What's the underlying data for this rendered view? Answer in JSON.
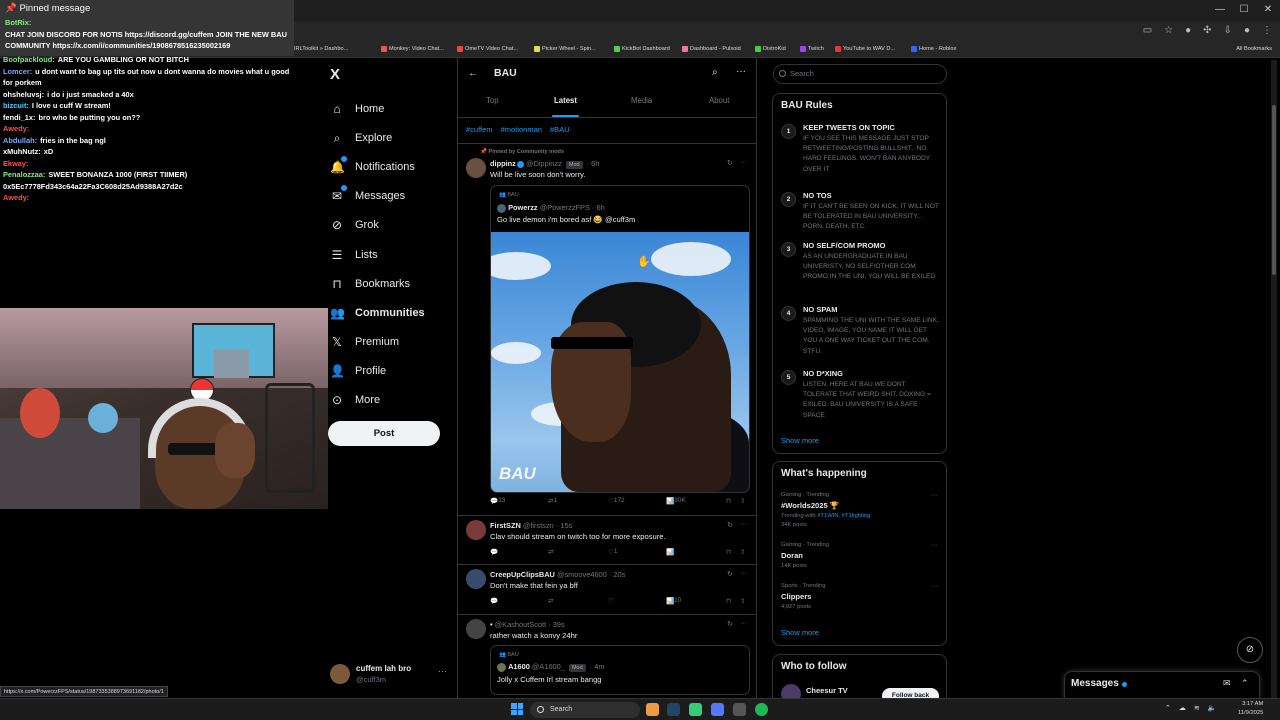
{
  "chat": {
    "pinned_title": "Pinned message",
    "pinned_author": "BotRix:",
    "pinned_text": "CHAT JOIN DISCORD FOR NOTIS https://discord.gg/cuffem JOIN THE NEW BAU COMMUNITY https://x.com/i/communities/1908678516235002169",
    "messages": [
      {
        "user": "Boofpackloud:",
        "text": "ARE YOU GAMBLING OR NOT BITCH",
        "color": "#7ef27e"
      },
      {
        "user": "Lomcer:",
        "text": "u dont want to bag up tits out now u dont wanna do movies what u good for porkem",
        "color": "#7aa8ff"
      },
      {
        "user": "ohsheluvsj:",
        "text": "i do i just smacked a 40x",
        "color": "#ffffff"
      },
      {
        "user": "bizcuit:",
        "text": "I love u cuff W stream!",
        "color": "#4fd0ff"
      },
      {
        "user": "fendi_1x:",
        "text": "bro who be putting you on??",
        "color": "#ffffff"
      },
      {
        "user": "Awedy:",
        "text": "",
        "color": "#ff5050"
      },
      {
        "user": "Abdullah:",
        "text": "fries in the bag ngl",
        "color": "#7aa8ff"
      },
      {
        "user": "xMuhNutz:",
        "text": "xD",
        "color": "#ffffff"
      },
      {
        "user": "Ekway:",
        "text": "",
        "color": "#ff5050"
      },
      {
        "user": "Penalozzaa:",
        "text": "SWEET BONANZA 1000 (FIRST TIIMER)",
        "color": "#7ef27e"
      },
      {
        "user": "",
        "text": "0x5Ec7778Fd343c64a22Fa3C608d25Ad9388A27d2c",
        "color": "#ffffff"
      },
      {
        "user": "Awedy:",
        "text": "",
        "color": "#ff5050"
      }
    ]
  },
  "bookmarks": [
    "IRLToolkit » Dashbo...",
    "Monkey: Video Chat...",
    "OmeTV Video Chat...",
    "Picker Wheel - Spin...",
    "KickBot Dashboard",
    "Dashboard - Pulsoid",
    "DistroKid",
    "Twitch",
    "YouTube to WAV D...",
    "Home - Roblox",
    "All Bookmarks"
  ],
  "nav": {
    "logo": "X",
    "items": [
      "Home",
      "Explore",
      "Notifications",
      "Messages",
      "Grok",
      "Lists",
      "Bookmarks",
      "Communities",
      "Premium",
      "Profile",
      "More"
    ],
    "icons": [
      "home-icon",
      "search-icon",
      "bell-icon",
      "mail-icon",
      "grok-icon",
      "list-icon",
      "bookmark-icon",
      "communities-icon",
      "x-icon",
      "profile-icon",
      "more-icon"
    ],
    "active": "Communities",
    "post_label": "Post",
    "account_name": "cuffem lah bro",
    "account_handle": "@cuff3m"
  },
  "community": {
    "back_glyph": "←",
    "title": "BAU",
    "tabs": [
      "Top",
      "Latest",
      "Media",
      "About"
    ],
    "active_tab": "Latest",
    "tags": [
      "#cuffem",
      "#motionman",
      "#BAU"
    ]
  },
  "tweets": {
    "t1": {
      "pinned": "Pinned by Community mods",
      "name": "dippinz",
      "handle": "@Dippinzz",
      "badge": "Mod",
      "time": "· 6h",
      "text": "Will be live soon don't worry.",
      "quote_community": "BAU",
      "quote_name": "Powerzz",
      "quote_handle": "@PowerzzFPS · 6h",
      "quote_text": "Go live demon i'm bored asf 😂 @cuff3m",
      "watermark": "BAU",
      "replies": "13",
      "reposts": "1",
      "likes": "172",
      "views": "30K"
    },
    "t2": {
      "name": "FirstSZN",
      "handle": "@firstszn · 15s",
      "text": "Clav should stream on twitch too for more exposure.",
      "likes": "1"
    },
    "t3": {
      "name": "CreepUpClipsBAU",
      "handle": "@smoove4600 · 20s",
      "text": "Don't make that fein ya bff",
      "views": "10"
    },
    "t4": {
      "name": "•",
      "handle": "@KashoutScott · 39s",
      "text": "rather watch a konvy 24hr",
      "quote_community": "BAU",
      "quote_name": "A1600",
      "quote_handle": "@A1600_",
      "quote_badge": "Mod",
      "quote_time": "· 4m",
      "quote_text": "Jolly x Cuffem Irl stream bangg"
    }
  },
  "right": {
    "search_placeholder": "Search",
    "rules_title": "BAU Rules",
    "rules": [
      {
        "n": "1",
        "title": "KEEP TWEETS ON TOPIC",
        "desc": "IF YOU SEE THIS MESSAGE JUST STOP RETWEETING/POSTING BULLSHIT.. NO HARD FEELINGS. WON'T BAN ANYBODY OVER IT"
      },
      {
        "n": "2",
        "title": "NO TOS",
        "desc": "IF IT CAN'T BE SEEN ON KICK, IT WILL NOT BE TOLERATED IN BAU UNIVERSITY... PORN, DEATH, ETC."
      },
      {
        "n": "3",
        "title": "NO SELF/COM PROMO",
        "desc": "AS AN UNDERGRADUATE IN BAU UNIVERISTY, NO SELF/OTHER COM PROMO IN THE UNI. YOU WILL BE EXILED"
      },
      {
        "n": "4",
        "title": "NO SPAM",
        "desc": "SPAMMING THE UNI WITH THE SAME LINK, VIDEO, IMAGE, YOU NAME IT WILL GET YOU A ONE WAY TICKET OUT THE COM. STFU."
      },
      {
        "n": "5",
        "title": "NO D*XING",
        "desc": "LISTEN. HERE AT BAU WE DONT TOLERATE THAT WEIRD SHIT. DOXING = EXILED. BAU UNIVERSITY IS A SAFE SPACE"
      }
    ],
    "show_more": "Show more",
    "happening_title": "What's happening",
    "trends": [
      {
        "cat": "Gaming · Trending",
        "name": "#Worlds2025 🏆",
        "sub_prefix": "Trending with ",
        "sub_link": "#T1WIN, #T1fighting"
      },
      {
        "cat": "Gaming · Trending",
        "name": "Doran",
        "sub_prefix": "14K posts",
        "sub_link": ""
      },
      {
        "cat": "Sports · Trending",
        "name": "Clippers",
        "sub_prefix": "4,927 posts",
        "sub_link": ""
      }
    ],
    "trend1_posts": "34K posts",
    "show_more2": "Show more",
    "follow_title": "Who to follow",
    "follow_name": "Cheesur TV",
    "follow_btn": "Follow back"
  },
  "dock": {
    "title": "Messages"
  },
  "status_url": "https://x.com/PowerzzFPS/status/1987335388973691182/photo/1",
  "taskbar": {
    "search": "Search",
    "time": "3:17 AM",
    "date": "11/9/2025"
  },
  "colors": {
    "accent": "#1d9bf0",
    "bg": "#000000",
    "border": "#2f3336",
    "muted": "#71767b"
  }
}
